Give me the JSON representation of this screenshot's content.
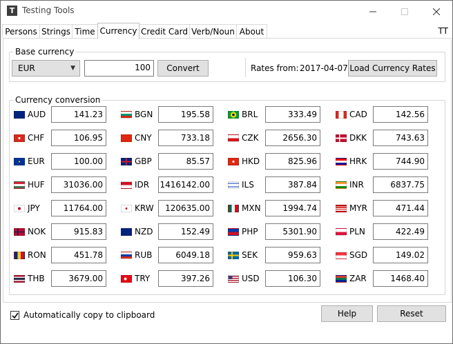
{
  "window": {
    "title": "Testing Tools"
  },
  "tabs": [
    {
      "label": "Persons",
      "active": false
    },
    {
      "label": "Strings",
      "active": false
    },
    {
      "label": "Time",
      "active": false
    },
    {
      "label": "Currency",
      "active": true
    },
    {
      "label": "Credit Card",
      "active": false
    },
    {
      "label": "Verb/Noun",
      "active": false
    },
    {
      "label": "About",
      "active": false
    }
  ],
  "tt_label": "TT",
  "base_currency": {
    "group_title": "Base currency",
    "selected": "EUR",
    "amount": "100",
    "convert_label": "Convert",
    "rates_from_label": "Rates from:",
    "rates_date": "2017-04-07",
    "load_label": "Load Currency Rates"
  },
  "conversion": {
    "group_title": "Currency conversion",
    "rows": [
      [
        {
          "code": "AUD",
          "value": "141.23",
          "flag": "aus"
        },
        {
          "code": "BGN",
          "value": "195.58",
          "flag": "bgn"
        },
        {
          "code": "BRL",
          "value": "333.49",
          "flag": "bra"
        },
        {
          "code": "CAD",
          "value": "142.56",
          "flag": "can"
        }
      ],
      [
        {
          "code": "CHF",
          "value": "106.95",
          "flag": "che"
        },
        {
          "code": "CNY",
          "value": "733.18",
          "flag": "chn"
        },
        {
          "code": "CZK",
          "value": "2656.30",
          "flag": "cze"
        },
        {
          "code": "DKK",
          "value": "743.63",
          "flag": "dnk"
        }
      ],
      [
        {
          "code": "EUR",
          "value": "100.00",
          "flag": "eur"
        },
        {
          "code": "GBP",
          "value": "85.57",
          "flag": "gbr"
        },
        {
          "code": "HKD",
          "value": "825.96",
          "flag": "hkg"
        },
        {
          "code": "HRK",
          "value": "744.90",
          "flag": "hrv"
        }
      ],
      [
        {
          "code": "HUF",
          "value": "31036.00",
          "flag": "hun"
        },
        {
          "code": "IDR",
          "value": "1416142.00",
          "flag": "idn"
        },
        {
          "code": "ILS",
          "value": "387.84",
          "flag": "isr"
        },
        {
          "code": "INR",
          "value": "6837.75",
          "flag": "ind"
        }
      ],
      [
        {
          "code": "JPY",
          "value": "11764.00",
          "flag": "jpn"
        },
        {
          "code": "KRW",
          "value": "120635.00",
          "flag": "kor"
        },
        {
          "code": "MXN",
          "value": "1994.74",
          "flag": "mex"
        },
        {
          "code": "MYR",
          "value": "471.44",
          "flag": "mys"
        }
      ],
      [
        {
          "code": "NOK",
          "value": "915.83",
          "flag": "nor"
        },
        {
          "code": "NZD",
          "value": "152.49",
          "flag": "nzl"
        },
        {
          "code": "PHP",
          "value": "5301.90",
          "flag": "phl"
        },
        {
          "code": "PLN",
          "value": "422.49",
          "flag": "pol"
        }
      ],
      [
        {
          "code": "RON",
          "value": "451.78",
          "flag": "rou"
        },
        {
          "code": "RUB",
          "value": "6049.18",
          "flag": "rus"
        },
        {
          "code": "SEK",
          "value": "959.63",
          "flag": "swe"
        },
        {
          "code": "SGD",
          "value": "149.02",
          "flag": "sgp"
        }
      ],
      [
        {
          "code": "THB",
          "value": "3679.00",
          "flag": "tha"
        },
        {
          "code": "TRY",
          "value": "397.26",
          "flag": "tur"
        },
        {
          "code": "USD",
          "value": "106.30",
          "flag": "usa"
        },
        {
          "code": "ZAR",
          "value": "1468.40",
          "flag": "zaf"
        }
      ]
    ]
  },
  "footer": {
    "auto_copy_label": "Automatically copy to clipboard",
    "auto_copy_checked": true,
    "help_label": "Help",
    "reset_label": "Reset"
  }
}
